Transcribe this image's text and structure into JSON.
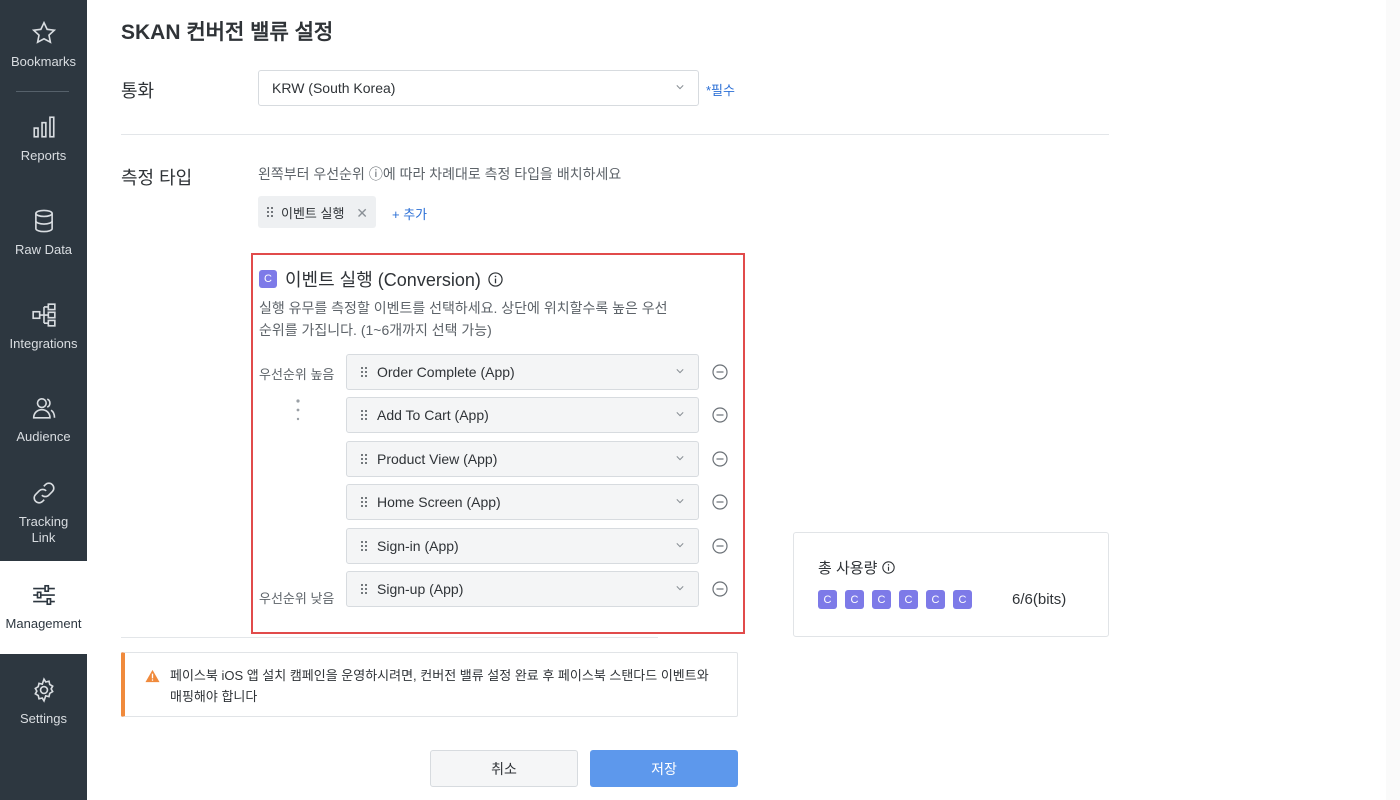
{
  "sidebar": {
    "items": [
      {
        "label": "Bookmarks",
        "icon": "star-icon"
      },
      {
        "label": "Reports",
        "icon": "bar-chart-icon"
      },
      {
        "label": "Raw Data",
        "icon": "database-icon"
      },
      {
        "label": "Integrations",
        "icon": "flow-icon"
      },
      {
        "label": "Audience",
        "icon": "users-icon"
      },
      {
        "label": "Tracking Link",
        "icon": "link-icon"
      },
      {
        "label": "Management",
        "icon": "sliders-icon",
        "active": true
      },
      {
        "label": "Settings",
        "icon": "gear-icon"
      }
    ]
  },
  "page": {
    "title": "SKAN 컨버전 밸류 설정"
  },
  "currency": {
    "label": "통화",
    "value": "KRW (South Korea)",
    "required": "*필수"
  },
  "measure": {
    "label": "측정 타입",
    "hint": "왼쪽부터  우선순위 ⓘ에 따라 차례대로 측정 타입을 배치하세요",
    "chip_label": "이벤트 실행",
    "add_label": "+ 추가"
  },
  "panel": {
    "badge": "C",
    "title": "이벤트 실행 (Conversion)",
    "description": "실행 유무를 측정할 이벤트를 선택하세요. 상단에 위치할수록 높은 우선순위를 가집니다. (1~6개까지 선택 가능)",
    "priority_high": "우선순위 높음",
    "priority_low": "우선순위 낮음",
    "events": [
      "Order Complete (App)",
      "Add To Cart (App)",
      "Product View (App)",
      "Home Screen (App)",
      "Sign-in (App)",
      "Sign-up (App)"
    ]
  },
  "usage": {
    "title": "총 사용량",
    "badges": [
      "C",
      "C",
      "C",
      "C",
      "C",
      "C"
    ],
    "bits": "6/6(bits)"
  },
  "warning": {
    "text": "페이스북 iOS 앱 설치 캠페인을 운영하시려면, 컨버전 밸류 설정 완료 후 페이스북 스탠다드 이벤트와 매핑해야 합니다"
  },
  "buttons": {
    "cancel": "취소",
    "save": "저장"
  },
  "colors": {
    "sidebar_bg": "#2d3740",
    "accent_blue": "#2b6fd6",
    "save_button": "#5d98ec",
    "badge_purple": "#7d7ae8",
    "highlight_border": "#e14b4b",
    "warning_orange": "#f08a3c"
  }
}
